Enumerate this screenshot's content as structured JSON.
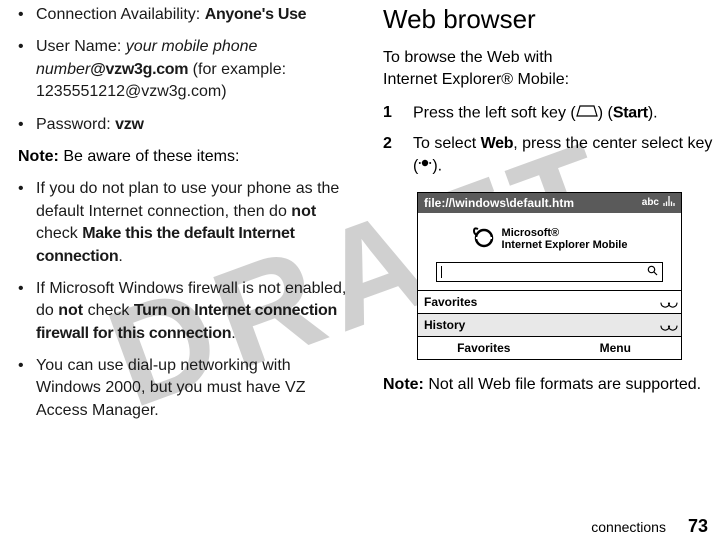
{
  "watermark": "DRAFT",
  "left": {
    "items": [
      {
        "prefix": "Connection Availability: ",
        "value": "Anyone's Use"
      },
      {
        "prefix": "User Name: ",
        "italic": "your mobile phone number",
        "bold_after": "@vzw3g.com",
        "suffix": " (for example: 1235551212@vzw3g.com)"
      },
      {
        "prefix": "Password: ",
        "value": "vzw"
      }
    ],
    "note_label": "Note:",
    "note_text": " Be aware of these items:",
    "bullets2": [
      {
        "pre": "If you do not plan to use your phone as the default Internet connection, then do ",
        "bold1": "not",
        "mid": " check ",
        "cond": "Make this the default Internet connection",
        "post": "."
      },
      {
        "pre": "If Microsoft Windows firewall is not enabled, do ",
        "bold1": "not",
        "mid": " check ",
        "cond": "Turn on Internet connection firewall for this connection",
        "post": "."
      },
      {
        "pre": "You can use dial-up networking with Windows 2000, but you must have VZ Access Manager."
      }
    ]
  },
  "right": {
    "heading": "Web browser",
    "intro1": "To browse the Web with",
    "intro2": "Internet Explorer® Mobile:",
    "steps": [
      {
        "n": "1",
        "pre": "Press the left soft key (",
        "post": ") (",
        "label": "Start",
        "end": ")."
      },
      {
        "n": "2",
        "pre": "To select ",
        "bold": "Web",
        "mid": ", press the center select key (",
        "end": ")."
      }
    ],
    "phone": {
      "title": "file://\\windows\\default.htm",
      "status_abc": "abc",
      "brand1": "Microsoft®",
      "brand2": "Internet Explorer Mobile",
      "row_fav": "Favorites",
      "row_hist": "History",
      "sk_left": "Favorites",
      "sk_right": "Menu"
    },
    "note_label": "Note:",
    "note_text": " Not all Web file formats are supported."
  },
  "footer": {
    "section": "connections",
    "page": "73"
  }
}
